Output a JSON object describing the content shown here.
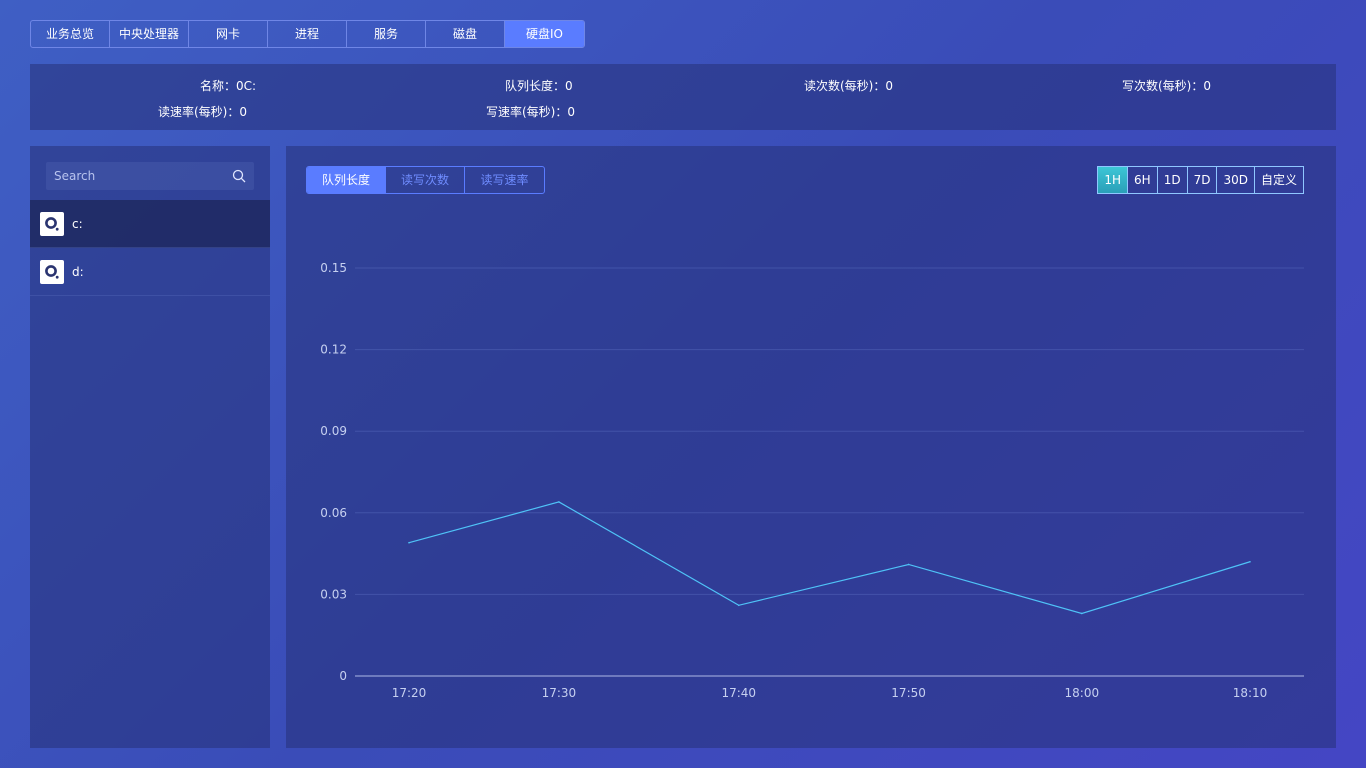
{
  "top_tabs": [
    "业务总览",
    "中央处理器",
    "网卡",
    "进程",
    "服务",
    "磁盘",
    "硬盘IO"
  ],
  "top_tab_active": "硬盘IO",
  "info": {
    "name": "名称：0C:",
    "queue_length": "队列长度：0",
    "reads_per_sec": "读次数(每秒)：0",
    "writes_per_sec": "写次数(每秒)：0",
    "read_rate": "读速率(每秒)：0",
    "write_rate": "写速率(每秒)：0"
  },
  "search": {
    "placeholder": "Search"
  },
  "disks": [
    {
      "label": "c:"
    },
    {
      "label": "d:"
    }
  ],
  "chart_tabs": [
    "队列长度",
    "读写次数",
    "读写速率"
  ],
  "range_tabs": [
    "1H",
    "6H",
    "1D",
    "7D",
    "30D",
    "自定义"
  ],
  "colors": {
    "accent": "#5a7cff",
    "line": "#4fc3f7",
    "range_active": "#3cc6d6"
  },
  "chart_data": {
    "type": "line",
    "x": [
      "17:20",
      "17:30",
      "17:40",
      "17:50",
      "18:00",
      "18:10"
    ],
    "x_numeric_minutes_from_first": [
      0,
      9,
      19.8,
      30,
      40.4,
      50.5
    ],
    "series": [
      {
        "values": [
          0.049,
          0.064,
          0.026,
          0.041,
          0.023,
          0.042
        ]
      }
    ],
    "yticks": [
      "0",
      "0.03",
      "0.06",
      "0.09",
      "0.12",
      "0.15"
    ],
    "ylim": [
      0,
      0.15
    ],
    "grid": true,
    "legend": "none"
  }
}
